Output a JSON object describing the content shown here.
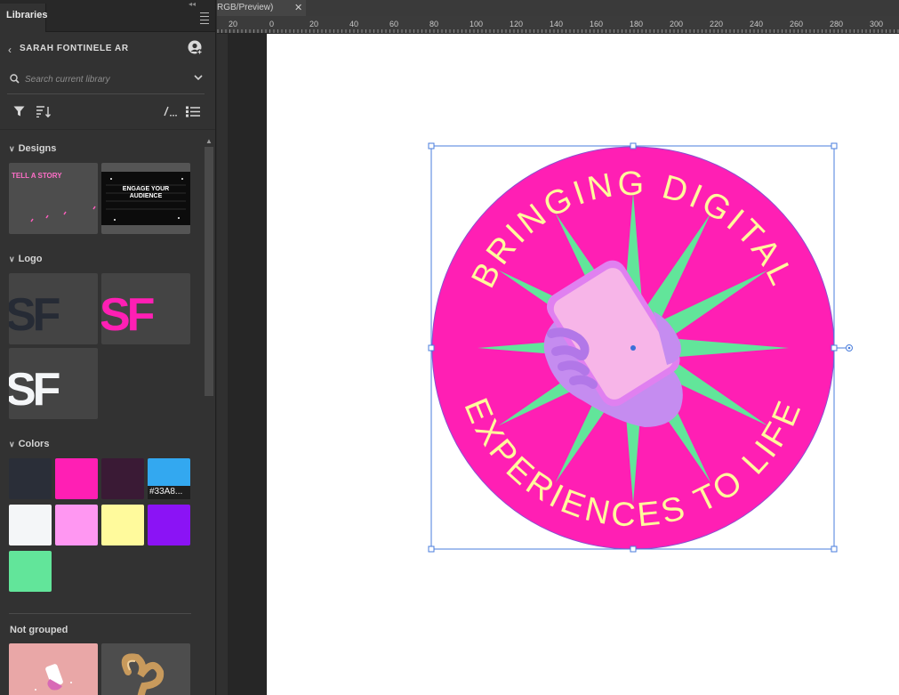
{
  "panel": {
    "tab_label": "Libraries",
    "library_name": "SARAH FONTINELE AR",
    "search": {
      "placeholder": "Search current library"
    }
  },
  "sections": {
    "designs": "Designs",
    "logo": "Logo",
    "colors": "Colors",
    "not_grouped": "Not grouped"
  },
  "designs": {
    "tile1_text": "TELL A STORY",
    "tile2_text": "ENGAGE YOUR AUDIENCE"
  },
  "logo": {
    "letters": "SF"
  },
  "colors": {
    "swatches": [
      {
        "hex": "#2A2E38",
        "name": "dark-slate"
      },
      {
        "hex": "#FF1FB4",
        "name": "hot-pink"
      },
      {
        "hex": "#3A1A35",
        "name": "dark-plum"
      },
      {
        "hex": "#33A8F0",
        "name": "sky-blue",
        "label": "#33A8..."
      },
      {
        "hex": "#F4F6F8",
        "name": "off-white"
      },
      {
        "hex": "#FF97F2",
        "name": "light-pink"
      },
      {
        "hex": "#FFFA9C",
        "name": "pale-yellow"
      },
      {
        "hex": "#8B13F5",
        "name": "violet"
      },
      {
        "hex": "#62E59A",
        "name": "mint-green"
      }
    ]
  },
  "document": {
    "tab_title": "RGB/Preview)",
    "ruler_labels": [
      "20",
      "0",
      "20",
      "40",
      "60",
      "80",
      "100",
      "120",
      "140",
      "160",
      "180",
      "200",
      "220",
      "240",
      "260",
      "280",
      "300"
    ]
  },
  "badge": {
    "top_text": "BRINGING DIGITAL",
    "bottom_text": "EXPERIENCES TO LIFE",
    "colors": {
      "circle": "#FF1FB4",
      "star": "#62E59A",
      "text": "#FFFA9C",
      "phone": "#F7B5E8",
      "hand": "#C58CF0"
    }
  },
  "icons": {
    "filter": "filter-icon",
    "sort": "sort-icon",
    "view": "grid-view-icon",
    "list": "list-view-icon",
    "user": "add-user-icon"
  }
}
